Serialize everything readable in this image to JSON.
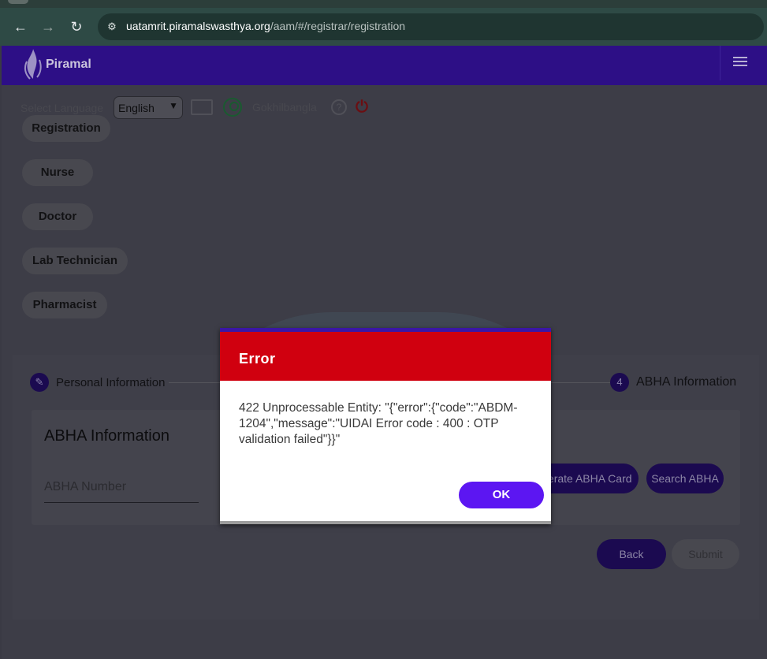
{
  "browser": {
    "url_host": "uatamrit.piramalswasthya.org",
    "url_path": "/aam/#/registrar/registration",
    "back_glyph": "←",
    "forward_glyph": "→",
    "reload_glyph": "↻",
    "site_info_glyph": "⚙"
  },
  "header": {
    "brand": "Piramal",
    "accent_color": "#2d0f86"
  },
  "toolbar": {
    "language_label": "Select Language",
    "language_selected": "English",
    "user_name": "Gokhilbangla",
    "help_glyph": "?",
    "power_glyph": "⏻"
  },
  "roles": [
    "Registration",
    "Nurse",
    "Doctor",
    "Lab Technician",
    "Pharmacist"
  ],
  "stepper": {
    "step1_label": "Personal Information",
    "step4_number": "4",
    "step4_label": "ABHA Information"
  },
  "abha": {
    "title": "ABHA Information",
    "input_placeholder": "ABHA Number",
    "generate_button": "Generate ABHA Card",
    "search_button": "Search ABHA"
  },
  "actions": {
    "back": "Back",
    "submit": "Submit"
  },
  "dialog": {
    "title": "Error",
    "message": "422 Unprocessable Entity: \"{\"error\":{\"code\":\"ABDM-1204\",\"message\":\"UIDAI Error code : 400 : OTP validation failed\"}}\"",
    "ok_label": "OK",
    "header_color": "#d0000f",
    "button_color": "#5c16f2"
  }
}
